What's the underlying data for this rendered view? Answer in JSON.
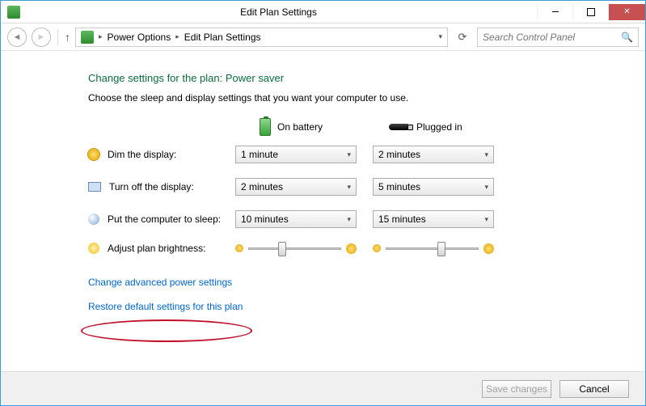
{
  "window": {
    "title": "Edit Plan Settings"
  },
  "breadcrumb": {
    "item1": "Power Options",
    "item2": "Edit Plan Settings"
  },
  "search": {
    "placeholder": "Search Control Panel"
  },
  "heading": "Change settings for the plan: Power saver",
  "subheading": "Choose the sleep and display settings that you want your computer to use.",
  "columns": {
    "battery": "On battery",
    "plugged": "Plugged in"
  },
  "rows": {
    "dim": {
      "label": "Dim the display:",
      "battery": "1 minute",
      "plugged": "2 minutes"
    },
    "off": {
      "label": "Turn off the display:",
      "battery": "2 minutes",
      "plugged": "5 minutes"
    },
    "sleep": {
      "label": "Put the computer to sleep:",
      "battery": "10 minutes",
      "plugged": "15 minutes"
    },
    "bright": {
      "label": "Adjust plan brightness:"
    }
  },
  "brightness": {
    "battery_pct": 40,
    "plugged_pct": 70
  },
  "links": {
    "advanced": "Change advanced power settings",
    "restore": "Restore default settings for this plan"
  },
  "buttons": {
    "save": "Save changes",
    "cancel": "Cancel"
  }
}
